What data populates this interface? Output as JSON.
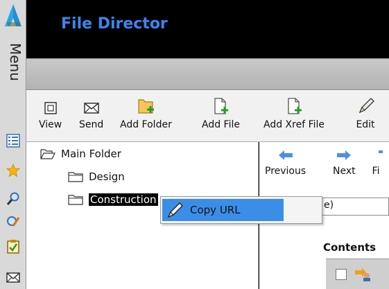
{
  "app": {
    "title": "File Director",
    "menu_label": "Menu"
  },
  "toolbar": {
    "buttons": [
      {
        "label": "View",
        "icon": "view-icon"
      },
      {
        "label": "Send",
        "icon": "envelope-icon"
      },
      {
        "label": "Add Folder",
        "icon": "add-folder-icon"
      },
      {
        "label": "Add File",
        "icon": "add-file-icon"
      },
      {
        "label": "Add Xref File",
        "icon": "add-xref-file-icon"
      },
      {
        "label": "Edit",
        "icon": "pencil-icon"
      }
    ]
  },
  "tree": {
    "root": "Main Folder",
    "children": [
      "Design",
      "Construction"
    ]
  },
  "navigation": {
    "previous": "Previous",
    "next": "Next",
    "partial": "Fi"
  },
  "filter": {
    "value": "e)"
  },
  "contents": {
    "heading": "Contents"
  },
  "context_menu": {
    "items": [
      {
        "label": "Copy URL",
        "icon": "pencil-icon"
      }
    ]
  },
  "sidebar_icons": [
    "list-icon",
    "star-icon",
    "search-icon",
    "edit-search-icon",
    "checklist-icon",
    "envelope-icon"
  ],
  "colors": {
    "accent": "#3a86f0",
    "selection": "#3b8ee8",
    "header": "#000000"
  }
}
